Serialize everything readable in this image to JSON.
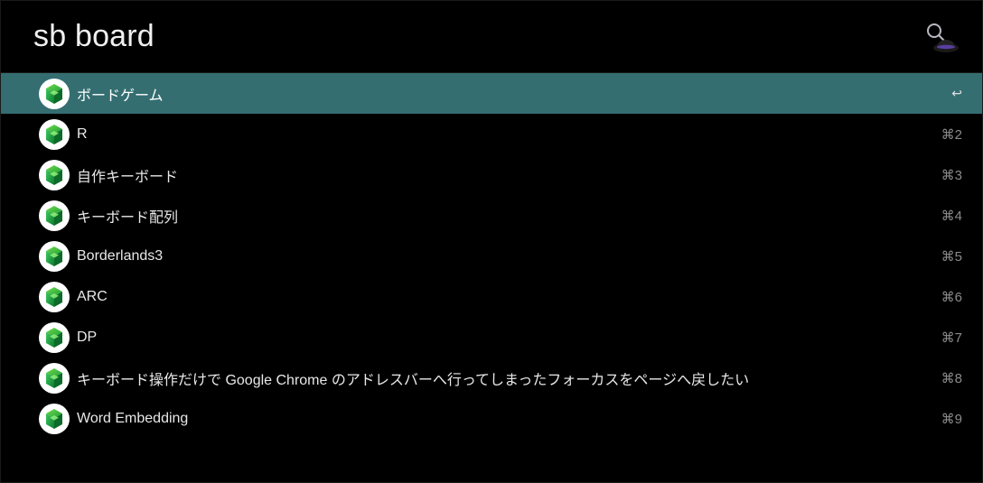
{
  "search": {
    "query": "sb board"
  },
  "results": [
    {
      "label": "ボードゲーム",
      "shortcut": "↩",
      "selected": true
    },
    {
      "label": "R",
      "shortcut": "⌘2",
      "selected": false
    },
    {
      "label": "自作キーボード",
      "shortcut": "⌘3",
      "selected": false
    },
    {
      "label": "キーボード配列",
      "shortcut": "⌘4",
      "selected": false
    },
    {
      "label": "Borderlands3",
      "shortcut": "⌘5",
      "selected": false
    },
    {
      "label": "ARC",
      "shortcut": "⌘6",
      "selected": false
    },
    {
      "label": "DP",
      "shortcut": "⌘7",
      "selected": false
    },
    {
      "label": "キーボード操作だけで Google Chrome のアドレスバーへ行ってしまったフォーカスをページへ戻したい",
      "shortcut": "⌘8",
      "selected": false
    },
    {
      "label": "Word Embedding",
      "shortcut": "⌘9",
      "selected": false
    }
  ]
}
